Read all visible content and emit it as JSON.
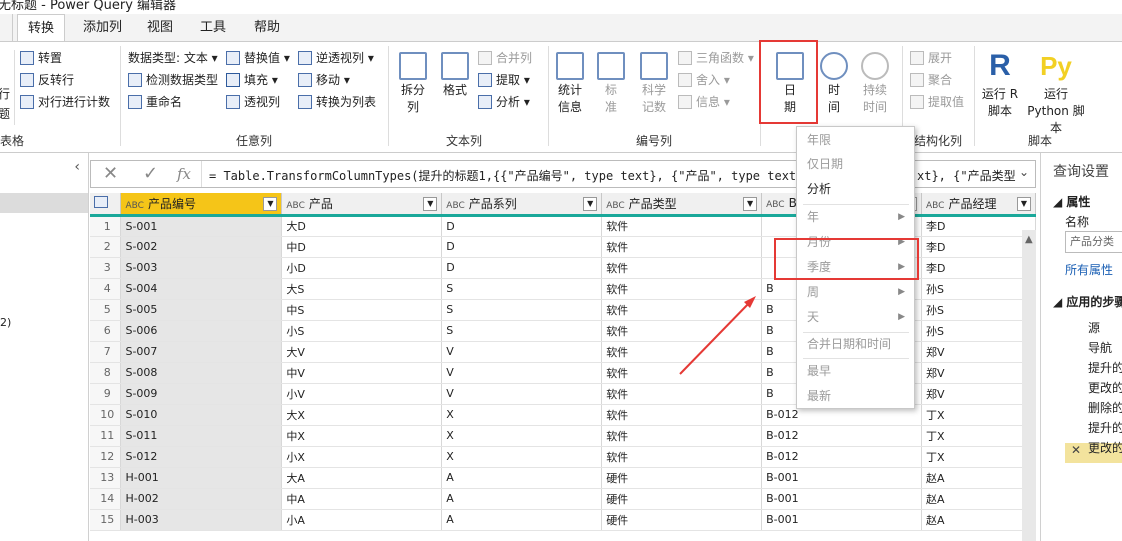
{
  "window": {
    "title": "无标题 - Power Query 编辑器"
  },
  "tabs": [
    "转换",
    "添加列",
    "视图",
    "工具",
    "帮助"
  ],
  "ribbon": {
    "table_group": {
      "label": "表格",
      "left_cut": "行",
      "left_cut2": "题"
    },
    "anycol_group": {
      "label": "任意列",
      "btn1": "转置",
      "btn2": "反转行",
      "btn3": "对行进行计数",
      "btn4": "数据类型: 文本",
      "btn5": "检测数据类型",
      "btn6": "重命名",
      "btn7": "替换值",
      "btn8": "填充",
      "btn9": "透视列",
      "btn10": "逆透视列",
      "btn11": "移动",
      "btn12": "转换为列表"
    },
    "text_group": {
      "label": "文本列",
      "split": "拆分列",
      "format": "格式",
      "merge": "合并列",
      "extract": "提取",
      "parse": "分析"
    },
    "number_group": {
      "label": "编号列",
      "stats": "统计信息",
      "standard": "标准",
      "scientific": "科学记数",
      "trig": "三角函数",
      "round": "舍入",
      "info": "信息"
    },
    "datetime_group": {
      "date": "日期",
      "time": "时间",
      "duration": "持续时间"
    },
    "struct_group": {
      "label": "结构化列",
      "expand": "展开",
      "aggregate": "聚合",
      "extract_values": "提取值"
    },
    "script_group": {
      "label": "脚本",
      "r": "运行 R 脚本",
      "python": "运行 Python 脚本",
      "r_glyph": "R",
      "py_glyph": "Py"
    }
  },
  "formula": "= Table.TransformColumnTypes(提升的标题1,{{\"产品编号\", type text}, {\"产品\", type text},",
  "formula_tail": "xt}, {\"产品类型",
  "columns": [
    "产品编号",
    "产品",
    "产品系列",
    "产品类型",
    "B",
    "产品经理"
  ],
  "rows": [
    [
      "1",
      "S-001",
      "大D",
      "D",
      "软件",
      "",
      "李D"
    ],
    [
      "2",
      "S-002",
      "中D",
      "D",
      "软件",
      "",
      "李D"
    ],
    [
      "3",
      "S-003",
      "小D",
      "D",
      "软件",
      "",
      "李D"
    ],
    [
      "4",
      "S-004",
      "大S",
      "S",
      "软件",
      "B",
      "孙S"
    ],
    [
      "5",
      "S-005",
      "中S",
      "S",
      "软件",
      "B",
      "孙S"
    ],
    [
      "6",
      "S-006",
      "小S",
      "S",
      "软件",
      "B",
      "孙S"
    ],
    [
      "7",
      "S-007",
      "大V",
      "V",
      "软件",
      "B",
      "郑V"
    ],
    [
      "8",
      "S-008",
      "中V",
      "V",
      "软件",
      "B",
      "郑V"
    ],
    [
      "9",
      "S-009",
      "小V",
      "V",
      "软件",
      "B",
      "郑V"
    ],
    [
      "10",
      "S-010",
      "大X",
      "X",
      "软件",
      "B-012",
      "丁X"
    ],
    [
      "11",
      "S-011",
      "中X",
      "X",
      "软件",
      "B-012",
      "丁X"
    ],
    [
      "12",
      "S-012",
      "小X",
      "X",
      "软件",
      "B-012",
      "丁X"
    ],
    [
      "13",
      "H-001",
      "大A",
      "A",
      "硬件",
      "B-001",
      "赵A"
    ],
    [
      "14",
      "H-002",
      "中A",
      "A",
      "硬件",
      "B-001",
      "赵A"
    ],
    [
      "15",
      "H-003",
      "小A",
      "A",
      "硬件",
      "B-001",
      "赵A"
    ]
  ],
  "date_menu": {
    "items": [
      "年限",
      "仅日期",
      "分析",
      "年",
      "月份",
      "季度",
      "周",
      "天",
      "合并日期和时间",
      "最早",
      "最新"
    ]
  },
  "right_panel": {
    "title": "查询设置",
    "props": "属性",
    "name_label": "名称",
    "name_value": "产品分类",
    "all_props": "所有属性",
    "steps_title": "应用的步骤",
    "steps": [
      "源",
      "导航",
      "提升的",
      "更改的",
      "删除的",
      "提升的",
      "更改的"
    ]
  },
  "left_panel": {
    "frag": "2)"
  }
}
